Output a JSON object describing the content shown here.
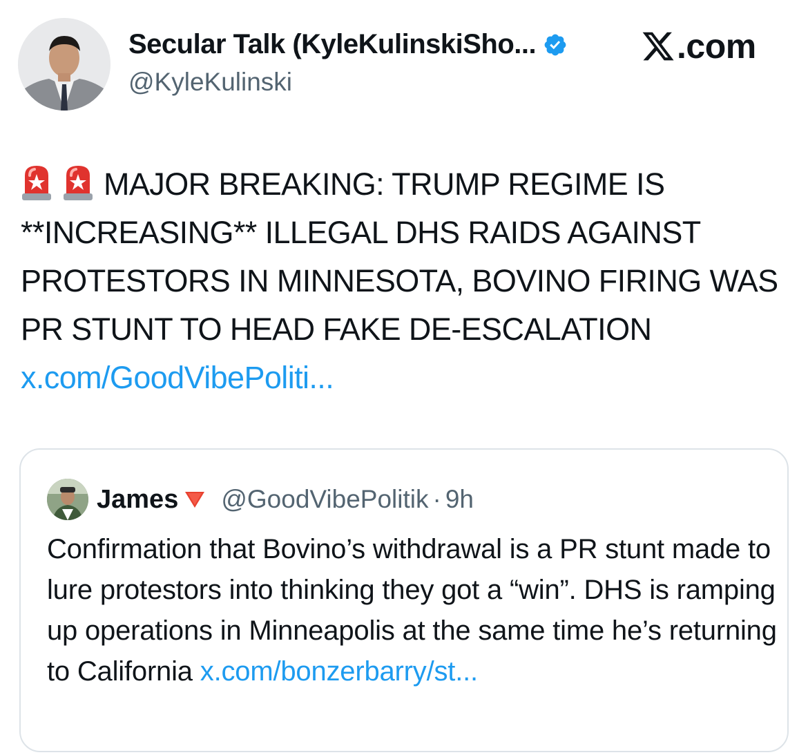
{
  "author": {
    "name": "Secular Talk (KyleKulinskiSho...",
    "handle": "@KyleKulinski",
    "verified": true
  },
  "brand": {
    "logo_icon": "x-logo-icon",
    "suffix": ".com"
  },
  "tweet": {
    "emoji": [
      "police-siren-icon",
      "police-siren-icon"
    ],
    "text": "MAJOR BREAKING: TRUMP REGIME IS **INCREASING** ILLEGAL DHS RAIDS AGAINST PROTESTORS IN MINNESOTA, BOVINO FIRING WAS PR STUNT TO HEAD FAKE DE-ESCALATION",
    "link": "x.com/GoodVibePoliti..."
  },
  "quote": {
    "name": "James",
    "name_badge": "red-down-triangle-icon",
    "handle": "@GoodVibePolitik",
    "separator": "·",
    "time": "9h",
    "text": "Confirmation that Bovino’s withdrawal is a PR stunt made to lure protestors into thinking they got a “win”. DHS is ramping up operations in Minneapolis at the same time he’s returning to California",
    "link": "x.com/bonzerbarry/st..."
  },
  "colors": {
    "link": "#1d9bf0",
    "verified": "#1d9bf0",
    "secondary_text": "#536471",
    "border": "#dde3e8"
  }
}
